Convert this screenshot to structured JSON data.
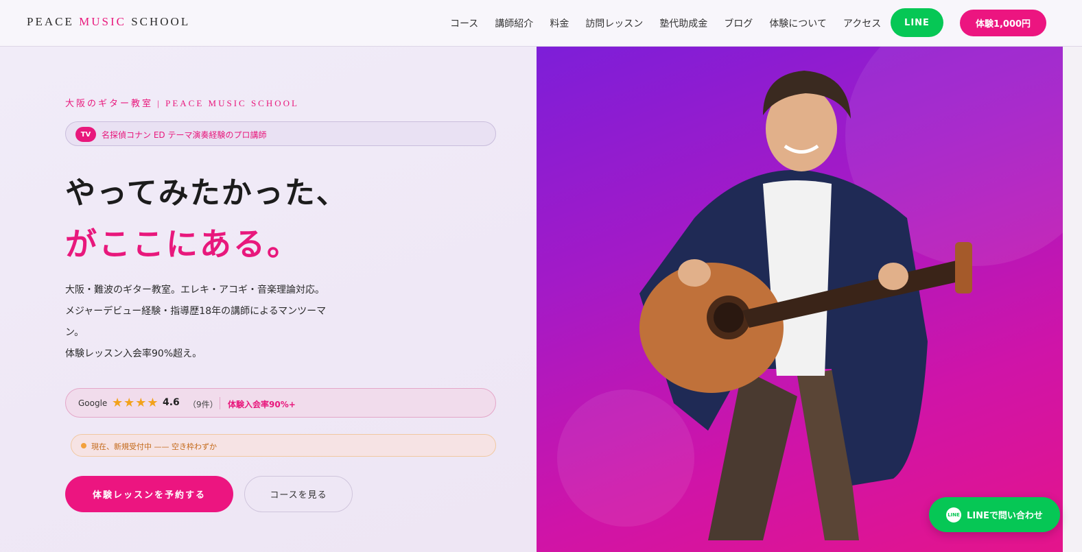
{
  "header": {
    "logo": {
      "part1": "PEACE ",
      "part2": "MUSIC",
      "part3": " SCHOOL"
    },
    "nav": [
      "コース",
      "講師紹介",
      "料金",
      "訪問レッスン",
      "塾代助成金",
      "ブログ",
      "体験について",
      "アクセス"
    ],
    "line_button": "LINE",
    "trial_button": "体験1,000円"
  },
  "hero": {
    "eyebrow": "大阪のギター教室 | PEACE MUSIC SCHOOL",
    "tv_badge": "TV",
    "tv_text": "名探偵コナン ED テーマ演奏経験のプロ講師",
    "headline_line1": "やってみたかった、",
    "headline_line2": "がここにある。",
    "description": [
      "大阪・難波のギター教室。エレキ・アコギ・音楽理論対応。",
      "メジャーデビュー経験・指導歴18年の講師によるマンツーマ",
      "ン。",
      "体験レッスン入会率90%超え。"
    ],
    "rating": {
      "source": "Google",
      "stars": "★★★★",
      "score": "4.6",
      "count": "（9件）",
      "join_rate": "体験入会率90%+"
    },
    "availability": "現在、新規受付中 —— 空き枠わずか",
    "book_button": "体験レッスンを予約する",
    "course_button": "コースを見る",
    "photo_subject": "acoustic-guitar-instructor-photo"
  },
  "floating": {
    "line_icon": "LINE",
    "line_contact": "LINEで問い合わせ"
  },
  "colors": {
    "accent": "#e8187c",
    "line_green": "#06c755",
    "hero_gradient_start": "#7d1ed8",
    "hero_gradient_end": "#e4148b",
    "star": "#f2a21b"
  }
}
